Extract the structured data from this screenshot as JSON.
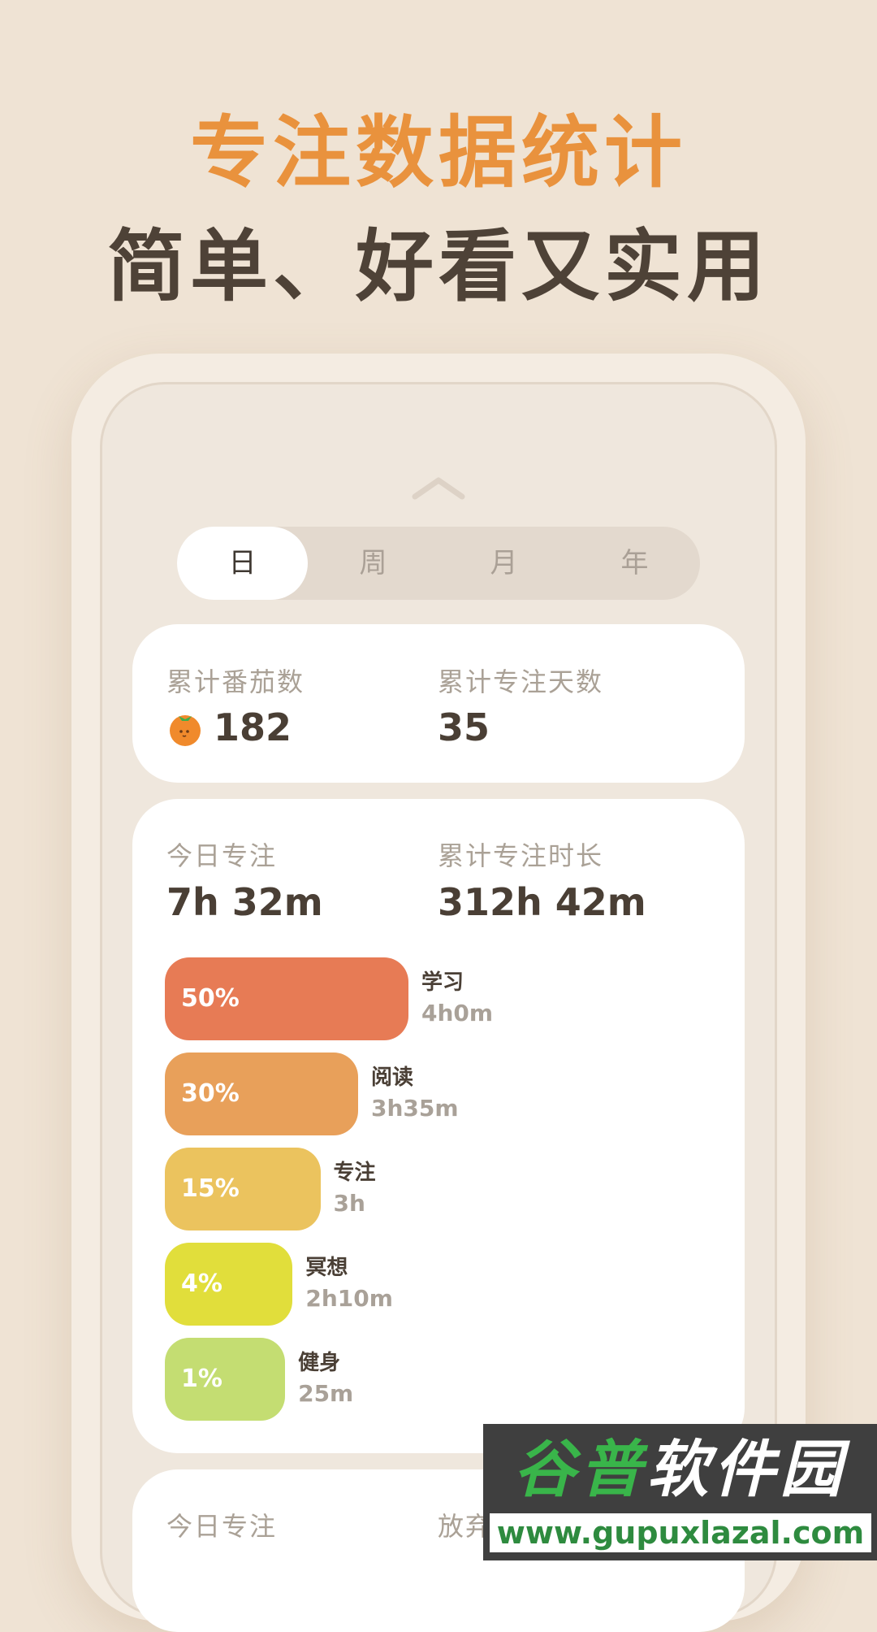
{
  "headline": {
    "line1": "专注数据统计",
    "line2": "简单、好看又实用"
  },
  "tabs": [
    {
      "label": "日",
      "active": true
    },
    {
      "label": "周",
      "active": false
    },
    {
      "label": "月",
      "active": false
    },
    {
      "label": "年",
      "active": false
    }
  ],
  "summary_card": {
    "tomato_label": "累计番茄数",
    "tomato_value": "182",
    "days_label": "累计专注天数",
    "days_value": "35"
  },
  "focus_card": {
    "today_label": "今日专注",
    "today_value": "7h 32m",
    "total_label": "累计专注时长",
    "total_value": "312h 42m",
    "categories": [
      {
        "percent": "50%",
        "name": "学习",
        "duration": "4h0m",
        "color": "#e77b55",
        "share": 0.5
      },
      {
        "percent": "30%",
        "name": "阅读",
        "duration": "3h35m",
        "color": "#e8a05a",
        "share": 0.3
      },
      {
        "percent": "15%",
        "name": "专注",
        "duration": "3h",
        "color": "#ebc35e",
        "share": 0.15
      },
      {
        "percent": "4%",
        "name": "冥想",
        "duration": "2h10m",
        "color": "#e1de3b",
        "share": 0.04
      },
      {
        "percent": "1%",
        "name": "健身",
        "duration": "25m",
        "color": "#c4dd72",
        "share": 0.01
      }
    ]
  },
  "third_card": {
    "today_label": "今日专注",
    "giveup_label": "放弃"
  },
  "watermark": {
    "brand_green": "谷普",
    "brand_white": "软件园",
    "url": "www.gupuxlazal.com"
  }
}
